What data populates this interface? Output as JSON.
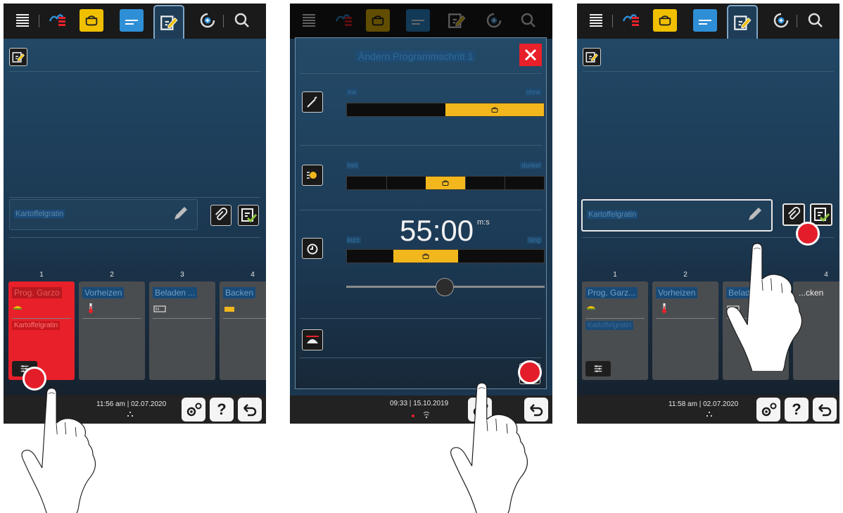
{
  "panel_left": {
    "program_name_placeholder": "Kartoffelgratin",
    "step_numbers": [
      "1",
      "2",
      "3",
      "4"
    ],
    "steps": [
      {
        "title": "Prog. Garzo",
        "subtitle": "Kartoffelgratin"
      },
      {
        "title": "Vorheizen"
      },
      {
        "title": "Beladen ..."
      },
      {
        "title": "Backen"
      }
    ],
    "time": "11:56 am",
    "date": "02.07.2020",
    "help_label": "?"
  },
  "panel_middle": {
    "dialog_title": "Ändern Programmschritt 1",
    "row1": {
      "left": "mit",
      "right": "ohne",
      "level_percent": 50
    },
    "row2": {
      "left": "hell",
      "right": "dunkel",
      "level_percent": 50
    },
    "row3": {
      "left": "kurz",
      "right": "lang",
      "level_percent": 40
    },
    "time_value": "55:00",
    "time_unit": "m:s",
    "slider_percent": 50,
    "time": "09:33",
    "date": "15.10.2019"
  },
  "panel_right": {
    "program_name_placeholder": "Kartoffelgratin",
    "step_numbers": [
      "1",
      "2",
      "3",
      "4"
    ],
    "steps": [
      {
        "title": "Prog. Garz..."
      },
      {
        "title": "Vorheizen"
      },
      {
        "title": "Belade"
      },
      {
        "title": "...cken"
      }
    ],
    "step1_subtitle": "Kartoffelgratin",
    "time": "11:58 am",
    "date": "02.07.2020",
    "help_label": "?"
  },
  "colors": {
    "panel_blue": "#1f3d57",
    "tabbar": "#1a1a1a",
    "accent_yellow": "#f0c000",
    "accent_blue": "#2f8fd6",
    "active_red": "#e8202a",
    "slider_fill": "#f1b71c",
    "card_grey": "#4a4d50"
  },
  "icons": [
    "menu-icon",
    "cooking-paths-icon",
    "cooking-mode-icon",
    "list-icon",
    "edit-program-icon",
    "refresh-plus-icon",
    "search-icon",
    "paperclip-icon",
    "save-check-icon",
    "settings-icon",
    "help-icon",
    "back-icon",
    "close-icon",
    "sensor-icon",
    "browning-icon",
    "timer-icon",
    "tray-icon",
    "controls-icon",
    "bowl-icon"
  ]
}
